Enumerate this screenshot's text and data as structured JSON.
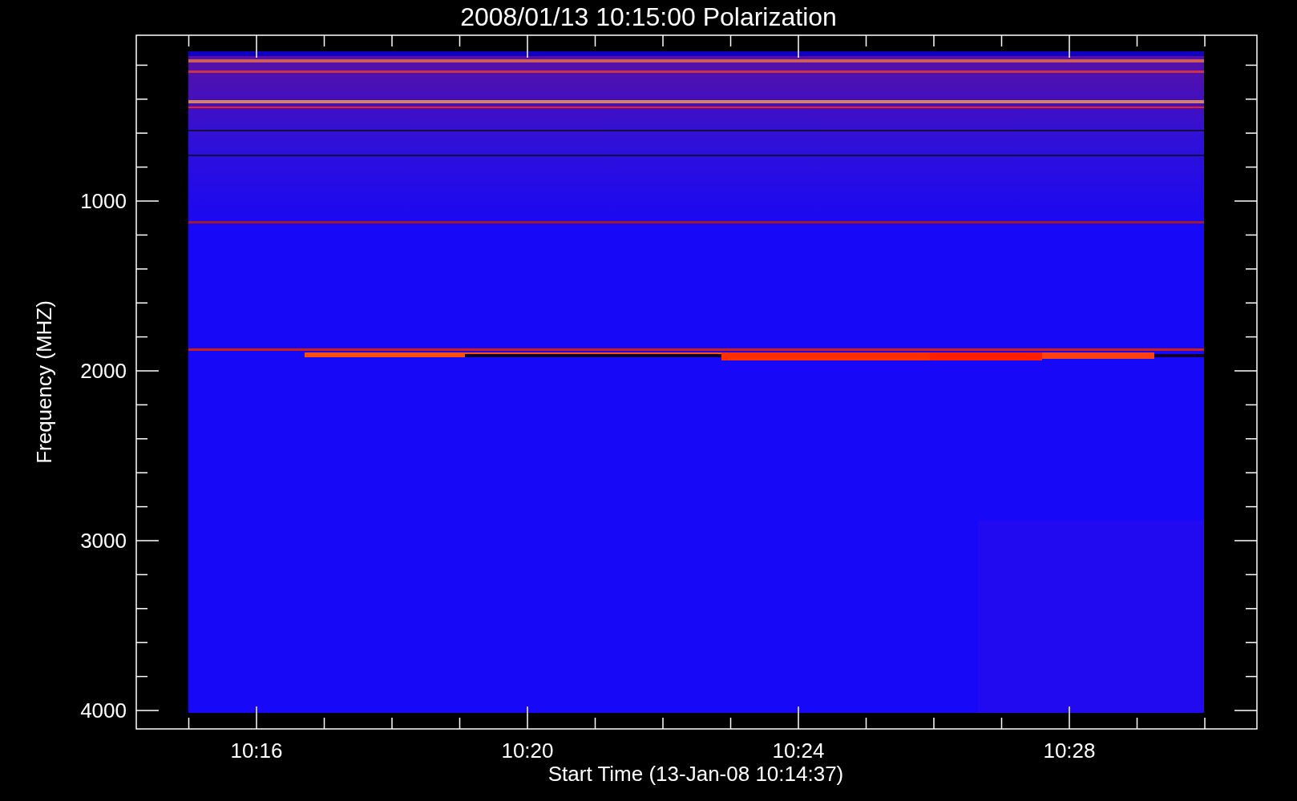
{
  "title": "2008/01/13 10:15:00 Polarization",
  "plot": {
    "ylabel": "Frequency (MHZ)",
    "xlabel": "Start Time (13-Jan-08 10:14:37)",
    "yticks": [
      "1000",
      "2000",
      "3000",
      "4000"
    ],
    "xticks": [
      "10:16",
      "10:20",
      "10:24",
      "10:28"
    ]
  }
}
